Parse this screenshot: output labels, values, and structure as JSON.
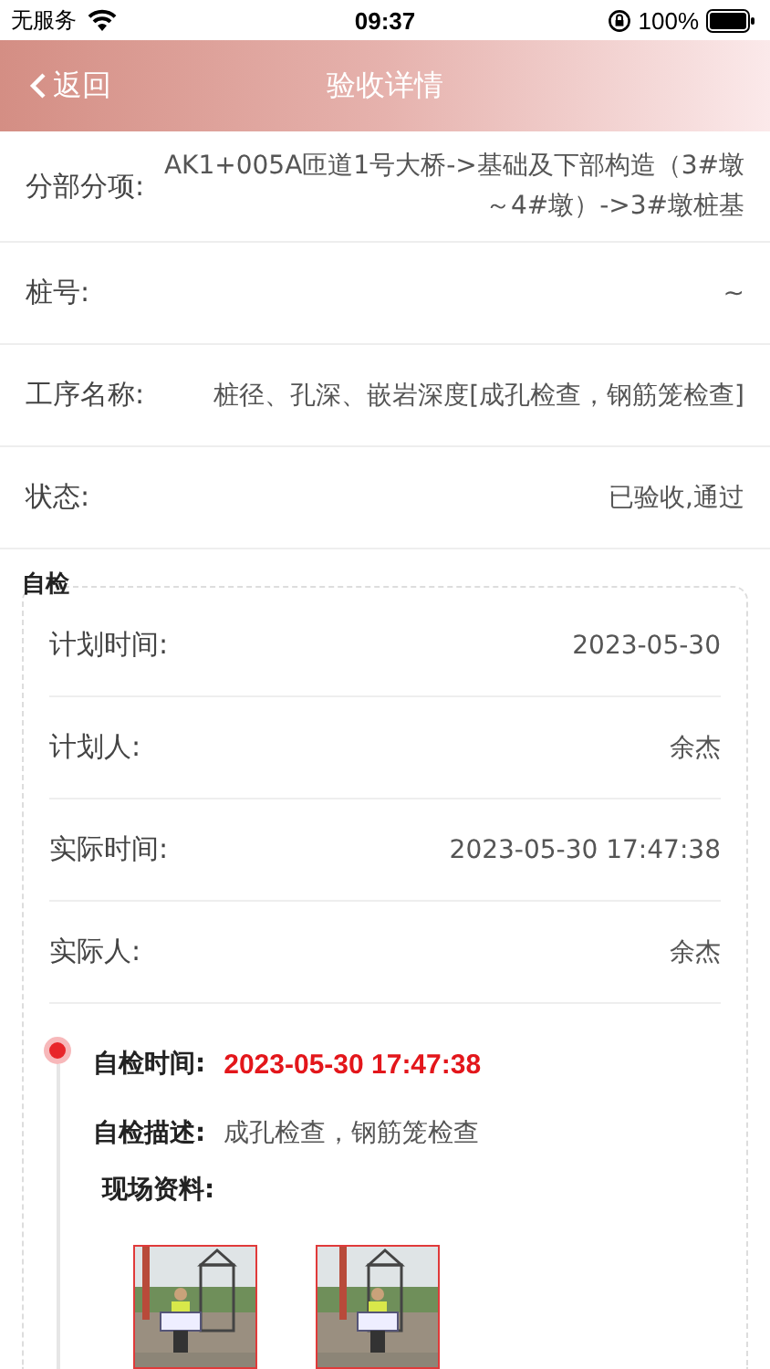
{
  "status_bar": {
    "carrier": "无服务",
    "time": "09:37",
    "battery": "100%"
  },
  "nav": {
    "back": "返回",
    "title": "验收详情"
  },
  "fields": [
    {
      "label": "分部分项:",
      "value": "AK1+005A匝道1号大桥->基础及下部构造（3#墩～4#墩）->3#墩桩基"
    },
    {
      "label": "桩号:",
      "value": "~"
    },
    {
      "label": "工序名称:",
      "value": "桩径、孔深、嵌岩深度[成孔检查，钢筋笼检查]"
    },
    {
      "label": "状态:",
      "value": "已验收,通过"
    }
  ],
  "self_check": {
    "title": "自检",
    "fields": [
      {
        "label": "计划时间:",
        "value": "2023-05-30"
      },
      {
        "label": "计划人:",
        "value": "余杰"
      },
      {
        "label": "实际时间:",
        "value": "2023-05-30 17:47:38"
      },
      {
        "label": "实际人:",
        "value": "余杰"
      }
    ],
    "record": {
      "time_label": "自检时间:",
      "time": "2023-05-30 17:47:38",
      "desc_label": "自检描述:",
      "desc": "成孔检查，钢筋笼检查",
      "photos_label": "现场资料:"
    }
  }
}
